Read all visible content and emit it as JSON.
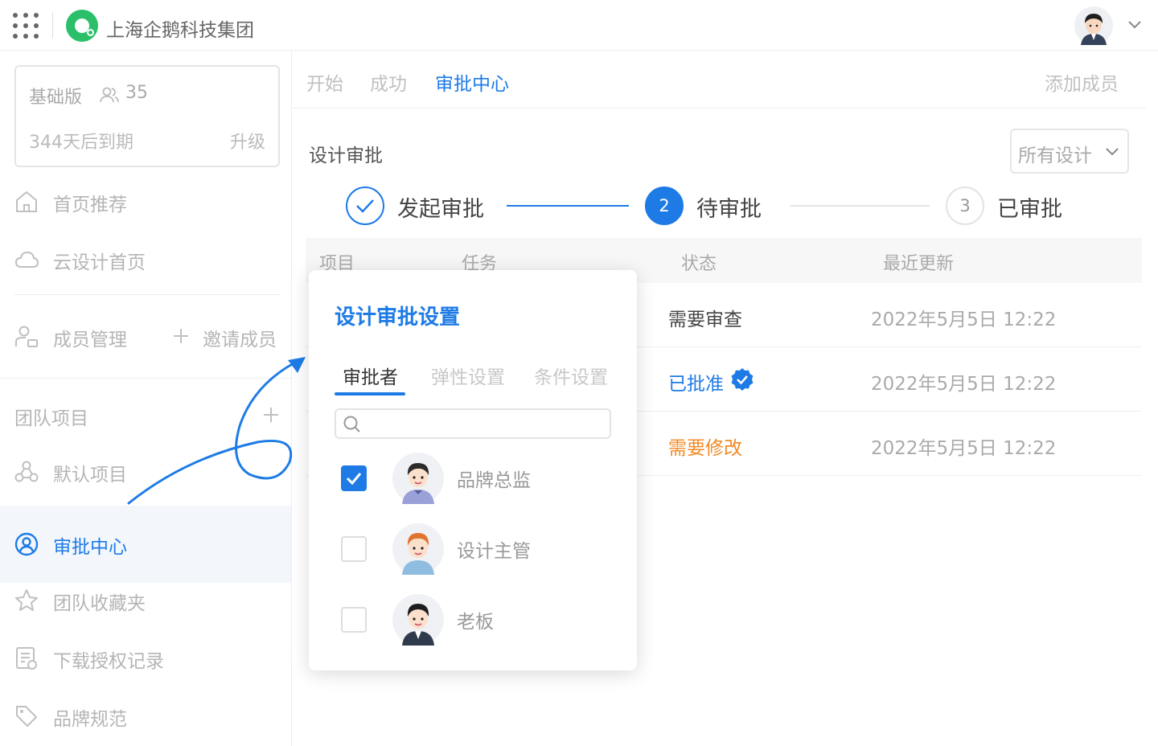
{
  "header": {
    "company": "上海企鹅科技集团"
  },
  "plan": {
    "name": "基础版",
    "member_count": "35",
    "expire": "344天后到期",
    "upgrade": "升级"
  },
  "sidebar": {
    "items": [
      {
        "label": "首页推荐",
        "icon": "home-icon"
      },
      {
        "label": "云设计首页",
        "icon": "cloud-icon"
      },
      {
        "label": "成员管理",
        "icon": "members-icon"
      },
      {
        "label": "默认项目",
        "icon": "project-icon"
      },
      {
        "label": "审批中心",
        "icon": "approval-icon"
      },
      {
        "label": "团队收藏夹",
        "icon": "star-icon"
      },
      {
        "label": "下载授权记录",
        "icon": "record-icon"
      },
      {
        "label": "品牌规范",
        "icon": "tag-icon"
      }
    ],
    "invite": "邀请成员",
    "section_title": "团队项目"
  },
  "tabs": [
    {
      "label": "开始"
    },
    {
      "label": "成功"
    },
    {
      "label": "审批中心"
    }
  ],
  "add_member": "添加成员",
  "page": {
    "title": "设计审批",
    "filter": "所有设计"
  },
  "steps": [
    {
      "label": "发起审批",
      "num": ""
    },
    {
      "label": "待审批",
      "num": "2"
    },
    {
      "label": "已审批",
      "num": "3"
    }
  ],
  "table": {
    "headers": [
      "项目",
      "任务",
      "状态",
      "最近更新"
    ],
    "rows": [
      {
        "status": "需要审查",
        "updated": "2022年5月5日 12:22"
      },
      {
        "status": "已批准",
        "updated": "2022年5月5日 12:22"
      },
      {
        "status": "需要修改",
        "updated": "2022年5月5日 12:22"
      }
    ]
  },
  "popup": {
    "title": "设计审批设置",
    "tabs": [
      "审批者",
      "弹性设置",
      "条件设置"
    ],
    "search_placeholder": "",
    "members": [
      {
        "name": "品牌总监",
        "checked": true
      },
      {
        "name": "设计主管",
        "checked": false
      },
      {
        "name": "老板",
        "checked": false
      }
    ]
  },
  "colors": {
    "accent": "#1e7be6",
    "brand": "#2bbf6a",
    "warning": "#f08a24"
  }
}
